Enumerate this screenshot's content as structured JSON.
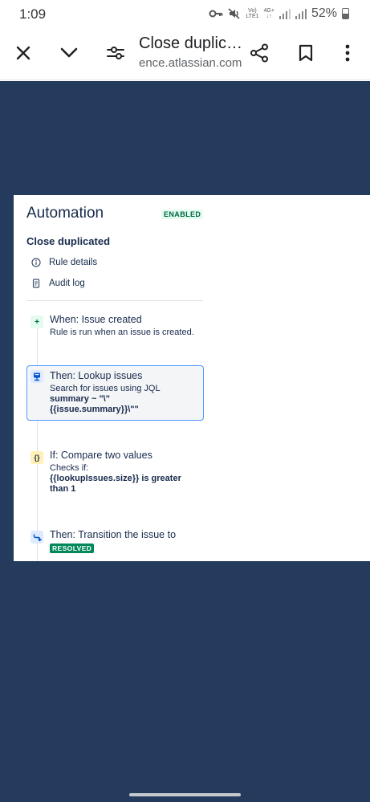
{
  "status_bar": {
    "time": "1:09",
    "signal_label_top": "Vo)",
    "signal_label_bottom": "LTE1",
    "network_label_top": "4G+",
    "network_label_bottom": "↓↑",
    "battery": "52%",
    "battery_level": 0.52
  },
  "browser": {
    "title": "Close duplic…",
    "url": "ence.atlassian.com"
  },
  "automation": {
    "title": "Automation",
    "status_badge": "ENABLED",
    "rule_name": "Close duplicated",
    "nav": [
      {
        "label": "Rule details",
        "icon": "info-icon"
      },
      {
        "label": "Audit log",
        "icon": "document-icon"
      }
    ],
    "steps": [
      {
        "icon": "plus-icon",
        "title": "When: Issue created",
        "desc": "Rule is run when an issue is created."
      },
      {
        "icon": "lookup-icon",
        "title": "Then: Lookup issues",
        "desc": "Search for issues using JQL",
        "desc_bold": "summary ~ \"\\\" {{issue.summary}}\\\"\""
      },
      {
        "icon": "braces-icon",
        "title": "If: Compare two values",
        "desc": "Checks if:",
        "desc_bold": "{{lookupIssues.size}} is greater than 1"
      },
      {
        "icon": "transition-icon",
        "title": "Then: Transition the issue to",
        "badge": "RESOLVED"
      }
    ]
  },
  "colors": {
    "page_background": "#243b5e",
    "selected_border": "#4c9aff",
    "enabled_green": "#006644",
    "resolved_green": "#00875a"
  }
}
